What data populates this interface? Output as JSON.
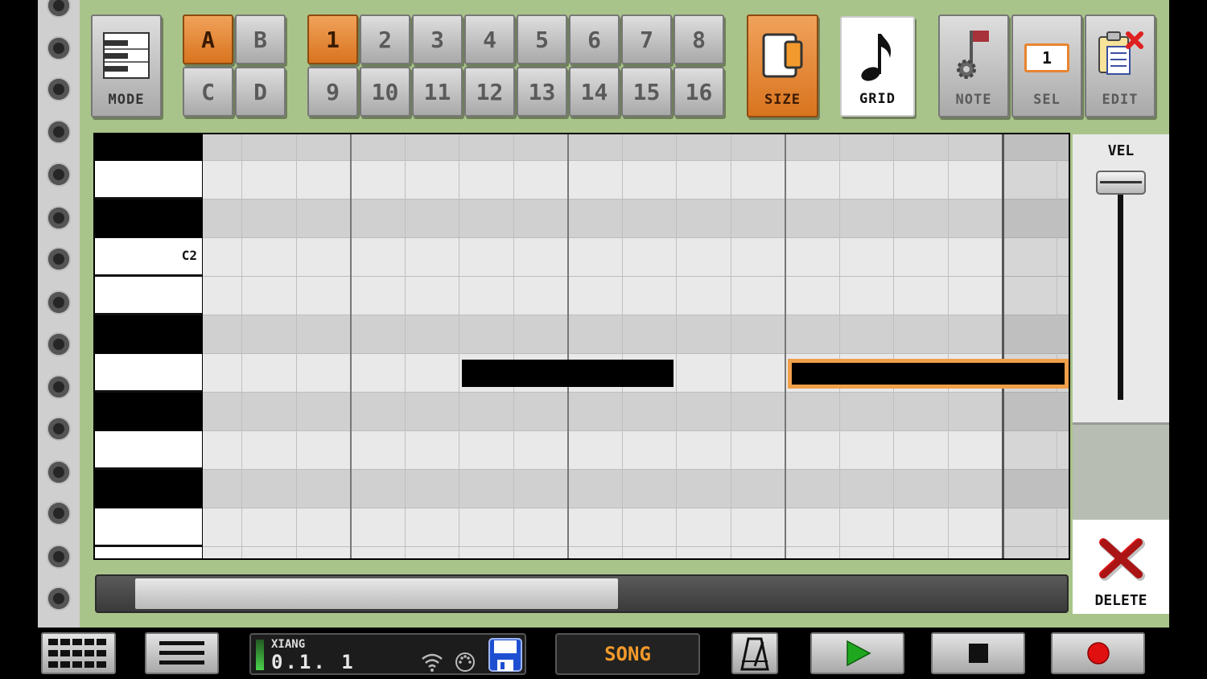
{
  "toolbar": {
    "mode_label": "MODE",
    "patterns": [
      "A",
      "B",
      "C",
      "D"
    ],
    "active_pattern": "A",
    "bars": [
      "1",
      "2",
      "3",
      "4",
      "5",
      "6",
      "7",
      "8",
      "9",
      "10",
      "11",
      "12",
      "13",
      "14",
      "15",
      "16"
    ],
    "active_bar": "1",
    "size_label": "SIZE",
    "grid_label": "GRID",
    "note_label": "NOTE",
    "sel_label": "SEL",
    "sel_value": "1",
    "edit_label": "EDIT"
  },
  "piano_roll": {
    "key_label": "C2",
    "selected_note_color": "#f0a04b"
  },
  "velocity": {
    "label": "VEL",
    "delete_label": "DELETE"
  },
  "status": {
    "song_name": "XIANG",
    "position": "0.1. 1",
    "song_button": "SONG"
  },
  "colors": {
    "panel": "#a9c48a",
    "accent": "#e8842f",
    "play": "#1fa81f",
    "record": "#e01010"
  }
}
